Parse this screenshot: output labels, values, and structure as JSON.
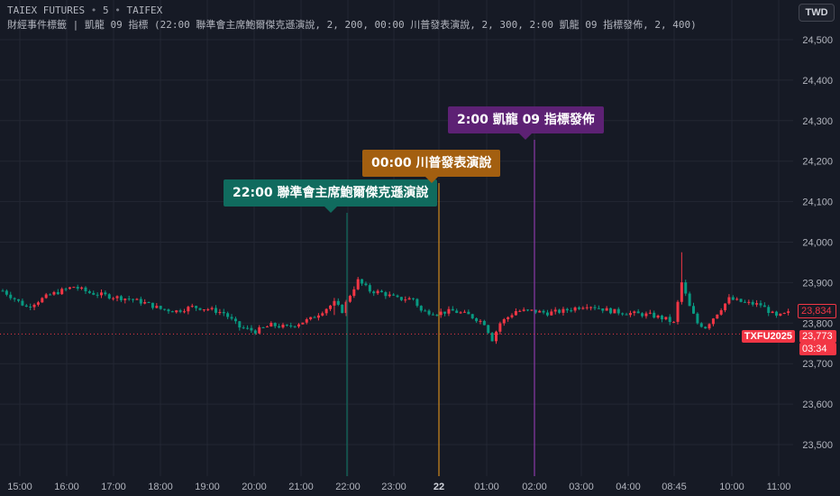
{
  "header": {
    "symbol": "TAIEX FUTURES",
    "interval": "5",
    "exchange": "TAIFEX",
    "indicator_text": "財經事件標籤 | 凱龍 09 指標 (22:00 聯準會主席鮑爾傑克遜演說, 2, 200, 00:00 川普發表演說, 2, 300, 2:00 凱龍 09 指標發佈, 2, 400)"
  },
  "currency_button": "TWD",
  "colors": {
    "background": "#161a25",
    "grid": "#232733",
    "up": "#f23645",
    "down": "#089981",
    "axis_text": "#b2b5be",
    "event1": "#106b5e",
    "event2": "#a35f10",
    "event3": "#5d2174"
  },
  "price_axis": {
    "ticks": [
      "24,500",
      "24,400",
      "24,300",
      "24,200",
      "24,100",
      "24,000",
      "23,900",
      "23,800",
      "23,700",
      "23,600",
      "23,500"
    ]
  },
  "time_axis": {
    "ticks": [
      "15:00",
      "16:00",
      "17:00",
      "18:00",
      "19:00",
      "20:00",
      "21:00",
      "22:00",
      "23:00",
      "22",
      "01:00",
      "02:00",
      "03:00",
      "04:00",
      "08:45",
      "10:00",
      "11:00"
    ]
  },
  "events": [
    {
      "text": "22:00 聯準會主席鮑爾傑克遜演說",
      "color": "#106b5e"
    },
    {
      "text": "00:00 川普發表演說",
      "color": "#a35f10"
    },
    {
      "text": "2:00 凱龍 09 指標發佈",
      "color": "#5d2174"
    }
  ],
  "price_labels": {
    "last_value": "23,834",
    "contract": "TXFU2025",
    "current_price": "23,773",
    "countdown": "03:34"
  },
  "chart_data": {
    "type": "candlestick",
    "ylim": [
      23450,
      24550
    ],
    "yticks": [
      24500,
      24400,
      24300,
      24200,
      24100,
      24000,
      23900,
      23800,
      23700,
      23600,
      23500
    ],
    "xticks": [
      "15:00",
      "16:00",
      "17:00",
      "18:00",
      "19:00",
      "20:00",
      "21:00",
      "22:00",
      "23:00",
      "22",
      "01:00",
      "02:00",
      "03:00",
      "04:00",
      "08:45",
      "10:00",
      "11:00"
    ],
    "event_times": [
      "22:00",
      "00:00",
      "02:00"
    ],
    "series": [
      {
        "anchors": [
          [
            0,
            23880
          ],
          [
            6,
            23840
          ],
          [
            12,
            23870
          ],
          [
            18,
            23890
          ],
          [
            22,
            23875
          ],
          [
            28,
            23865
          ],
          [
            32,
            23860
          ],
          [
            36,
            23850
          ],
          [
            40,
            23835
          ],
          [
            44,
            23830
          ],
          [
            48,
            23840
          ],
          [
            52,
            23835
          ],
          [
            56,
            23825
          ],
          [
            60,
            23790
          ],
          [
            64,
            23780
          ],
          [
            68,
            23795
          ],
          [
            72,
            23790
          ],
          [
            78,
            23810
          ],
          [
            84,
            23850
          ],
          [
            86,
            23830
          ],
          [
            88,
            23870
          ],
          [
            90,
            23905
          ],
          [
            93,
            23880
          ],
          [
            96,
            23875
          ],
          [
            100,
            23860
          ],
          [
            104,
            23860
          ],
          [
            106,
            23830
          ],
          [
            110,
            23825
          ],
          [
            114,
            23830
          ],
          [
            118,
            23820
          ],
          [
            122,
            23800
          ],
          [
            124,
            23760
          ],
          [
            126,
            23800
          ],
          [
            130,
            23830
          ],
          [
            134,
            23830
          ],
          [
            138,
            23825
          ],
          [
            142,
            23830
          ],
          [
            148,
            23845
          ],
          [
            154,
            23830
          ],
          [
            158,
            23825
          ],
          [
            164,
            23820
          ],
          [
            168,
            23810
          ],
          [
            170,
            23800
          ],
          [
            172,
            23900
          ],
          [
            174,
            23840
          ],
          [
            176,
            23800
          ],
          [
            178,
            23790
          ],
          [
            181,
            23825
          ],
          [
            184,
            23860
          ],
          [
            188,
            23850
          ],
          [
            192,
            23845
          ],
          [
            196,
            23815
          ],
          [
            199,
            23825
          ]
        ],
        "spikes": [
          [
            84,
            23820
          ],
          [
            172,
            23975
          ]
        ]
      }
    ]
  }
}
